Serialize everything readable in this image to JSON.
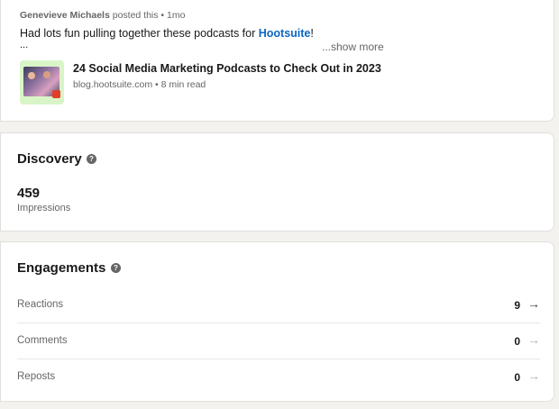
{
  "post": {
    "author": "Genevieve Michaels",
    "posted_text": "posted this • 1mo",
    "text_before": "Had lots fun pulling together these podcasts for ",
    "text_link": "Hootsuite",
    "text_after": "!",
    "ellipsis": "...",
    "show_more": "...show more",
    "article": {
      "title": "24 Social Media Marketing Podcasts to Check Out in 2023",
      "meta": "blog.hootsuite.com • 8 min read"
    }
  },
  "discovery": {
    "title": "Discovery",
    "help_icon": "?",
    "impressions_value": "459",
    "impressions_label": "Impressions"
  },
  "engagements": {
    "title": "Engagements",
    "help_icon": "?",
    "rows": [
      {
        "label": "Reactions",
        "count": "9",
        "arrow": "→"
      },
      {
        "label": "Comments",
        "count": "0",
        "arrow": "→"
      },
      {
        "label": "Reposts",
        "count": "0",
        "arrow": "→"
      }
    ]
  }
}
